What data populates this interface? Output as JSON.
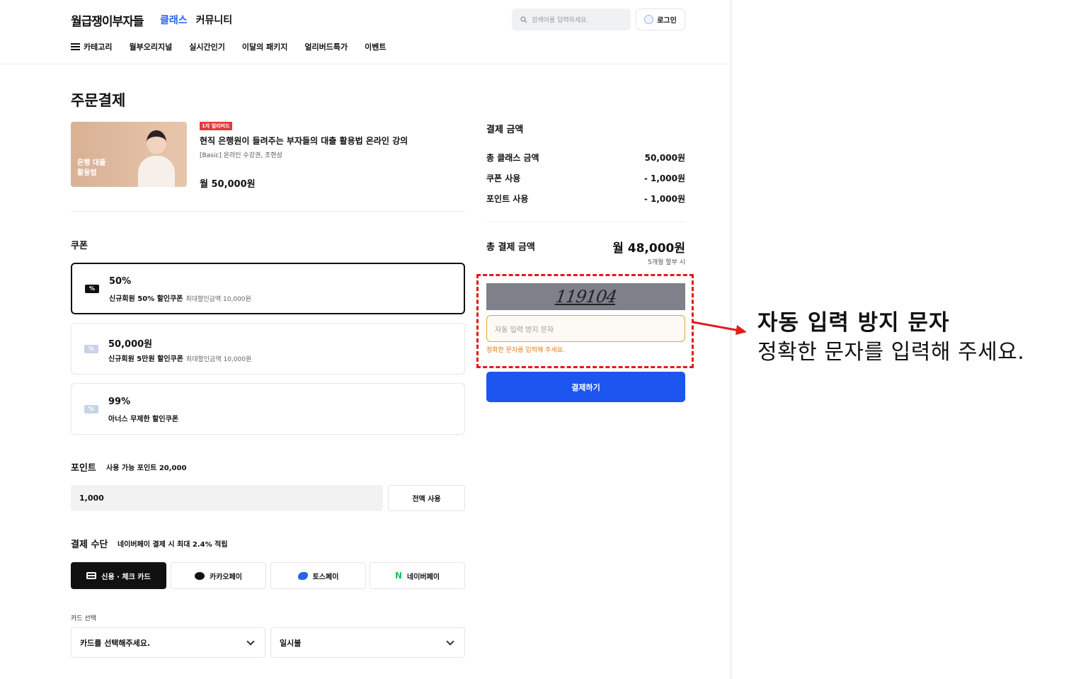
{
  "header": {
    "logo": "월급쟁이부자들",
    "nav": [
      "클래스",
      "커뮤니티"
    ],
    "search_placeholder": "검색어를 입력하세요.",
    "login": "로그인"
  },
  "subnav": {
    "category": "카테고리",
    "items": [
      "월부오리지널",
      "실시간인기",
      "이달의 패키지",
      "얼리버드특가",
      "이벤트"
    ]
  },
  "page_title": "주문결제",
  "course": {
    "thumb_text": "은행 대출 활용법",
    "badge": "1차 얼리버드",
    "title": "현직 은행원이 들려주는 부자들의 대출 활용법 온라인 강의",
    "subtitle": "[Basic] 온라인 수강권, 조현성",
    "price": "월 50,000원"
  },
  "coupon": {
    "label": "쿠폰",
    "items": [
      {
        "value": "50%",
        "name": "신규회원 50% 할인쿠폰",
        "limit": "최대할인금액 10,000원",
        "selected": true
      },
      {
        "value": "50,000원",
        "name": "신규회원 5만원 할인쿠폰",
        "limit": "최대할인금액 10,000원",
        "selected": false
      },
      {
        "value": "99%",
        "name": "아너스 무제한 할인쿠폰",
        "limit": "",
        "selected": false
      }
    ]
  },
  "points": {
    "label": "포인트",
    "available": "사용 가능 포인트 20,000",
    "value": "1,000",
    "use_all": "전액 사용"
  },
  "payment": {
    "label": "결제 수단",
    "note": "네이버페이 결제 시 최대 2.4% 적립",
    "methods": [
      "신용 · 체크 카드",
      "카카오페이",
      "토스페이",
      "네이버페이"
    ],
    "card_select_label": "카드 선택",
    "card_select_value": "카드를 선택해주세요.",
    "installment_value": "일시불"
  },
  "summary": {
    "title": "결제 금액",
    "rows": [
      {
        "label": "총 클래스 금액",
        "value": "50,000원"
      },
      {
        "label": "쿠폰 사용",
        "value": "- 1,000원"
      },
      {
        "label": "포인트 사용",
        "value": "- 1,000원"
      }
    ],
    "total_label": "총 결제 금액",
    "total_value": "월 48,000원",
    "total_note": "5개월 할부 시",
    "captcha_text": "119104",
    "captcha_placeholder": "자동 입력 방지 문자",
    "captcha_error": "정확한 문자를 입력해 주세요.",
    "pay_button": "결제하기"
  },
  "annotation": {
    "title": "자동 입력 방지 문자",
    "desc": "정확한 문자를 입력해 주세요.",
    "color": "#e21b1b"
  },
  "colors": {
    "accent": "#1d55f0",
    "error": "#e07b1c",
    "highlight": "#e21b1b"
  }
}
